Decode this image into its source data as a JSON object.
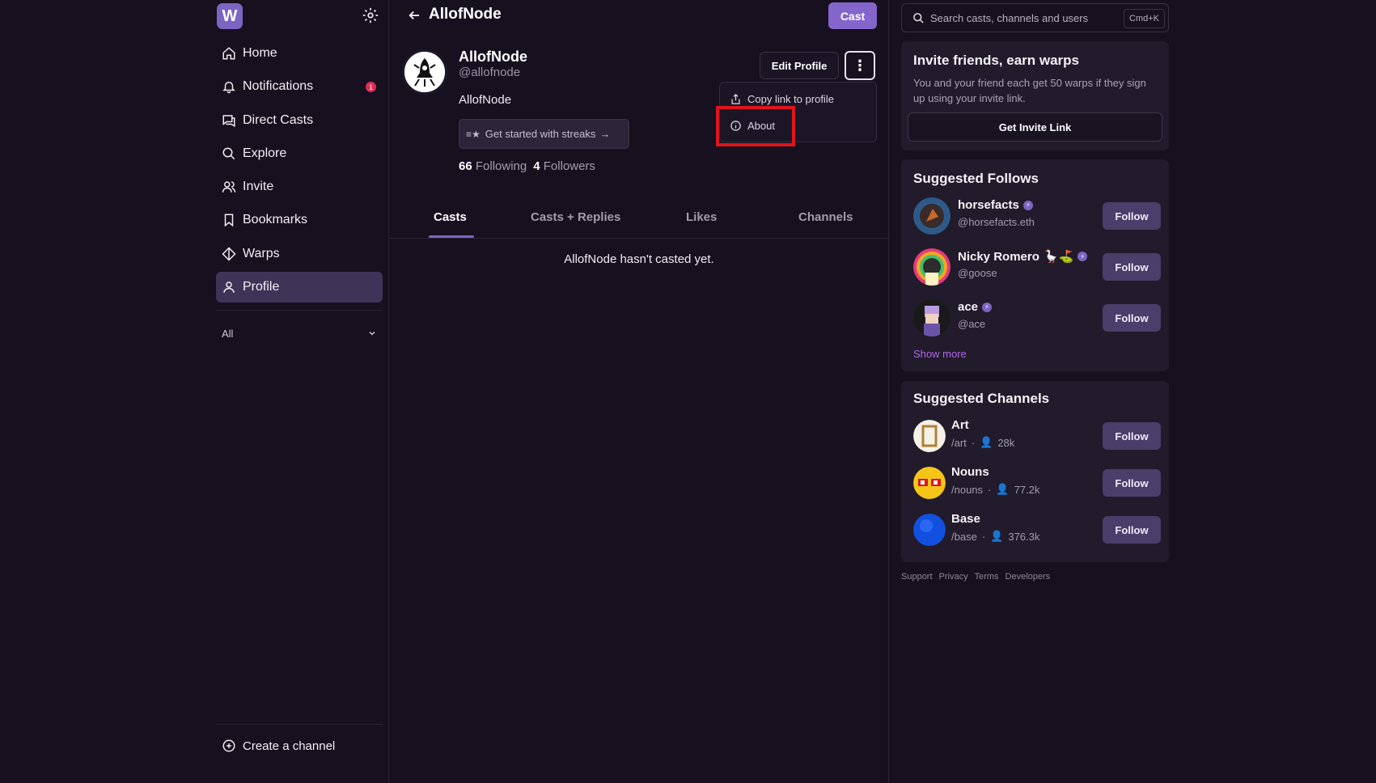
{
  "sidebar": {
    "logo": "W",
    "items": [
      {
        "label": "Home"
      },
      {
        "label": "Notifications",
        "badge": "1"
      },
      {
        "label": "Direct Casts"
      },
      {
        "label": "Explore"
      },
      {
        "label": "Invite"
      },
      {
        "label": "Bookmarks"
      },
      {
        "label": "Warps"
      },
      {
        "label": "Profile"
      }
    ],
    "filter": "All",
    "create_channel": "Create a channel"
  },
  "header": {
    "title": "AllofNode",
    "cast_button": "Cast"
  },
  "profile": {
    "name": "AllofNode",
    "handle": "@allofnode",
    "bio": "AllofNode",
    "streaks_button": "Get started with streaks",
    "following_count": "66",
    "following_label": "Following",
    "followers_count": "4",
    "followers_label": "Followers",
    "edit_button": "Edit Profile",
    "menu": {
      "copy_link": "Copy link to profile",
      "about": "About"
    }
  },
  "tabs": [
    "Casts",
    "Casts + Replies",
    "Likes",
    "Channels"
  ],
  "empty_message": "AllofNode hasn't casted yet.",
  "search": {
    "placeholder": "Search casts, channels and users",
    "shortcut": "Cmd+K"
  },
  "invite": {
    "title": "Invite friends, earn warps",
    "text": "You and your friend each get 50 warps if they sign up using your invite link.",
    "button": "Get Invite Link"
  },
  "suggested_follows": {
    "title": "Suggested Follows",
    "users": [
      {
        "name": "horsefacts",
        "handle": "@horsefacts.eth",
        "button": "Follow"
      },
      {
        "name": "Nicky Romero",
        "emoji": "🪿⛳",
        "handle": "@goose",
        "button": "Follow"
      },
      {
        "name": "ace",
        "handle": "@ace",
        "button": "Follow"
      }
    ],
    "show_more": "Show more"
  },
  "suggested_channels": {
    "title": "Suggested Channels",
    "channels": [
      {
        "name": "Art",
        "path": "/art",
        "members": "28k",
        "button": "Follow"
      },
      {
        "name": "Nouns",
        "path": "/nouns",
        "members": "77.2k",
        "button": "Follow"
      },
      {
        "name": "Base",
        "path": "/base",
        "members": "376.3k",
        "button": "Follow"
      }
    ]
  },
  "footer": [
    "Support",
    "Privacy",
    "Terms",
    "Developers"
  ],
  "colors": {
    "background": "#17101f",
    "accent": "#7c65c1",
    "card": "#221b2c",
    "highlight": "#e0141d"
  }
}
